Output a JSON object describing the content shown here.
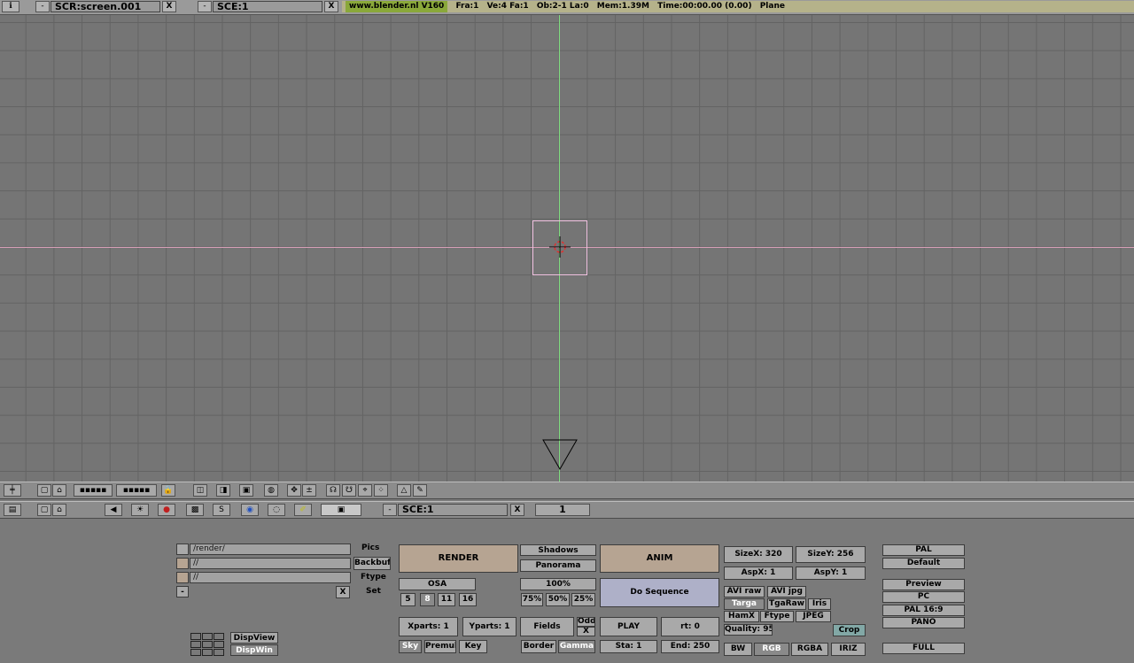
{
  "topbar": {
    "screen_field": "SCR:screen.001",
    "scene_field": "SCE:1",
    "close_glyph": "X",
    "menu_glyph": "-",
    "info": [
      "www.blender.nl V160",
      "Fra:1",
      "Ve:4 Fa:1",
      "Ob:2-1 La:0",
      "Mem:1.39M",
      "Time:00:00.00 (0.00)",
      "Plane"
    ]
  },
  "buttons_header": {
    "scene_field": "SCE:1",
    "close_glyph": "X",
    "menu_glyph": "-",
    "frame": "1"
  },
  "output": {
    "pics_path": "/render/",
    "pics_label": "Pics",
    "backbuf_path": "//",
    "backbuf_label": "Backbuf",
    "ftype_path": "//",
    "ftype_label": "Ftype",
    "set_menu": "-",
    "set_x": "X",
    "set_label": "Set"
  },
  "disp": {
    "view": "DispView",
    "win": "DispWin"
  },
  "render": {
    "render": "RENDER",
    "osa": "OSA",
    "osa_levels": [
      "5",
      "8",
      "11",
      "16"
    ],
    "xparts": "Xparts: 1",
    "yparts": "Yparts: 1",
    "sky": "Sky",
    "premul": "Premul",
    "key": "Key",
    "shadows": "Shadows",
    "panorama": "Panorama",
    "percent": "100%",
    "sizes": [
      "75%",
      "50%",
      "25%"
    ],
    "fields": "Fields",
    "odd": "Odd",
    "x": "X",
    "border": "Border",
    "gamma": "Gamma"
  },
  "anim": {
    "anim": "ANIM",
    "do_sequence": "Do Sequence",
    "play": "PLAY",
    "rt": "rt: 0",
    "sta": "Sta: 1",
    "end": "End: 250"
  },
  "format": {
    "sizex": "SizeX: 320",
    "sizey": "SizeY: 256",
    "aspx": "AspX: 1",
    "aspy": "AspY: 1",
    "avi_raw": "AVI raw",
    "avi_jpg": "AVI jpg",
    "targa": "Targa",
    "tgaraw": "TgaRaw",
    "iris": "Iris",
    "hamx": "HamX",
    "ftype": "Ftype",
    "jpeg": "JPEG",
    "quality": "Quality: 95",
    "crop": "Crop",
    "bw": "BW",
    "rgb": "RGB",
    "rgba": "RGBA",
    "iriz": "IRIZ"
  },
  "presets": {
    "pal": "PAL",
    "default": "Default",
    "preview": "Preview",
    "pc": "PC",
    "pal169": "PAL 16:9",
    "pano": "PANO",
    "full": "FULL"
  },
  "colors": {
    "x_axis": "#d8a0b8",
    "y_axis": "#7fdc7f",
    "selection": "#f0c0e0"
  }
}
